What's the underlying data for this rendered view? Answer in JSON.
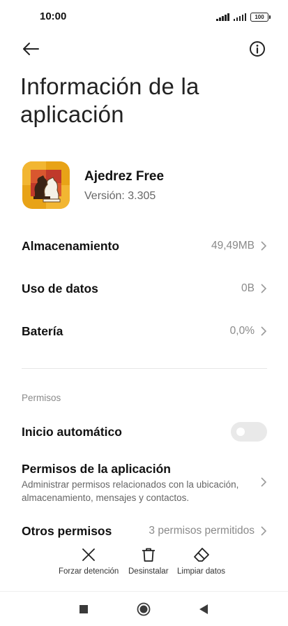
{
  "status_bar": {
    "time": "10:00",
    "battery": "100"
  },
  "header": {
    "title": "Información de la aplicación"
  },
  "app": {
    "name": "Ajedrez Free",
    "version": "Versión: 3.305",
    "icon_colors": [
      "#e8a317",
      "#c0392b",
      "#f2c94c"
    ]
  },
  "rows": {
    "storage": {
      "label": "Almacenamiento",
      "value": "49,49MB"
    },
    "data_usage": {
      "label": "Uso de datos",
      "value": "0B"
    },
    "battery": {
      "label": "Batería",
      "value": "0,0%"
    },
    "other_perms": {
      "label": "Otros permisos",
      "value": "3 permisos permitidos"
    }
  },
  "permissions_section": {
    "label": "Permisos",
    "autostart": {
      "label": "Inicio automático",
      "enabled": false
    },
    "app_permissions": {
      "title": "Permisos de la aplicación",
      "description": "Administrar permisos relacionados con la ubicación, almacenamiento, mensajes y contactos."
    }
  },
  "actions": {
    "force_stop": "Forzar detención",
    "uninstall": "Desinstalar",
    "clear_data": "Limpiar datos"
  },
  "icons": {
    "back": "arrow-left-icon",
    "info": "info-circle-icon",
    "chevron": "chevron-right-icon",
    "force_stop": "close-x-icon",
    "uninstall": "trash-icon",
    "clear_data": "eraser-icon",
    "nav_recents": "square-icon",
    "nav_home": "circle-icon",
    "nav_back": "triangle-back-icon"
  }
}
